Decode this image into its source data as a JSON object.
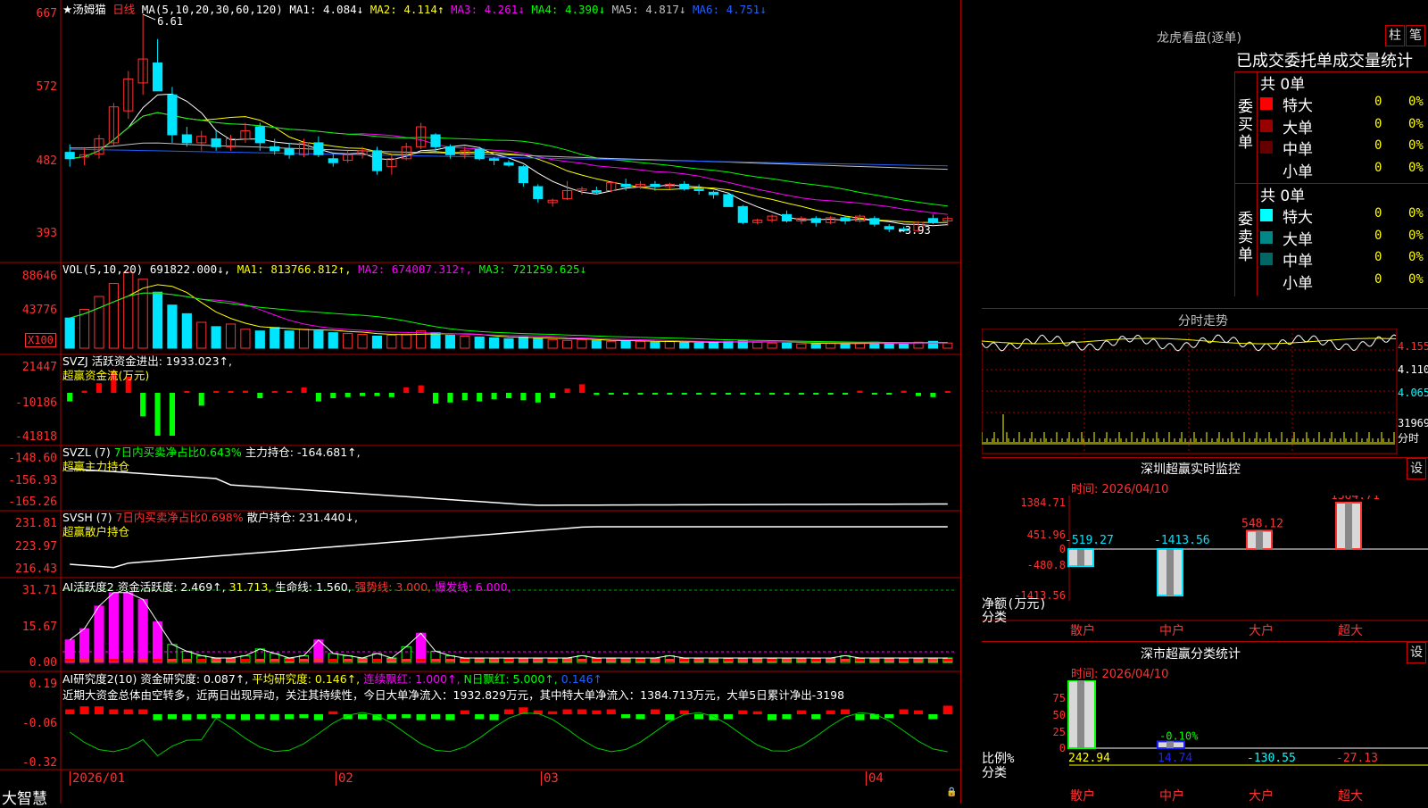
{
  "colors": {
    "up": "#ff3232",
    "down": "#00e5ff",
    "grid": "#b00000",
    "axis": "#ff3232"
  },
  "header": {
    "title": "★汤姆猫",
    "period": "日线",
    "ma_params": "MA(5,10,20,30,60,120)",
    "ma": [
      {
        "label": "MA1: 4.084↓",
        "color": "#ffffff"
      },
      {
        "label": "MA2: 4.114↑",
        "color": "#ffff00"
      },
      {
        "label": "MA3: 4.261↓",
        "color": "#ff00ff"
      },
      {
        "label": "MA4: 4.390↓",
        "color": "#00ff00"
      },
      {
        "label": "MA5: 4.817↓",
        "color": "#c0c0c0"
      },
      {
        "label": "MA6: 4.751↓",
        "color": "#2060ff"
      }
    ],
    "high_mark": "6.61",
    "low_mark": "←3.93"
  },
  "price_axis": [
    "667",
    "572",
    "482",
    "393"
  ],
  "vol": {
    "title": "VOL(5,10,20)",
    "value": "691822.000↓,",
    "ma": [
      {
        "label": "MA1: 813766.812↑,",
        "color": "#ffff00"
      },
      {
        "label": "MA2: 674007.312↑,",
        "color": "#ff00ff"
      },
      {
        "label": "MA3: 721259.625↓",
        "color": "#00ff00"
      }
    ],
    "axis": [
      "88646",
      "43776"
    ],
    "unit": "X100"
  },
  "svzj": {
    "title": "SVZJ",
    "line1": "活跃资金进出: 1933.023↑,",
    "line2": "超赢资金流(万元)",
    "axis": [
      "21447",
      "-10186",
      "-41818"
    ]
  },
  "svzl": {
    "title": "SVZL (7)",
    "ratio": "7日内买卖净占比0.643%",
    "value": "主力持仓: -164.681↑,",
    "line2": "超赢主力持仓",
    "axis": [
      "-148.60",
      "-156.93",
      "-165.26"
    ]
  },
  "svsh": {
    "title": "SVSH (7)",
    "ratio": "7日内买卖净占比0.698%",
    "value": "散户持仓: 231.440↓,",
    "line2": "超赢散户持仓",
    "axis": [
      "231.81",
      "223.97",
      "216.43"
    ]
  },
  "ai_active": {
    "title": "AI活跃度2",
    "items": [
      {
        "label": "资金活跃度: 2.469↑,",
        "color": "#ffffff"
      },
      {
        "label": "31.713,",
        "color": "#ffff00"
      },
      {
        "label": "生命线: 1.560,",
        "color": "#ffffff"
      },
      {
        "label": "强势线: 3.000,",
        "color": "#ff3232"
      },
      {
        "label": "爆发线: 6.000,",
        "color": "#ff00ff"
      }
    ],
    "axis": [
      "31.71",
      "15.67",
      "0.00"
    ]
  },
  "ai_research": {
    "title": "AI研究度2(10)",
    "items": [
      {
        "label": "资金研究度: 0.087↑,",
        "color": "#ffffff"
      },
      {
        "label": "平均研究度: 0.146↑,",
        "color": "#ffff00"
      },
      {
        "label": "连续飘红: 1.000↑,",
        "color": "#ff00ff"
      },
      {
        "label": "N日飘红: 5.000↑,",
        "color": "#00ff00"
      },
      {
        "label": "0.146↑",
        "color": "#2060ff"
      }
    ],
    "comment": "近期大资金总体由空转多，近两日出现异动，关注其持续性，今日大单净流入：1932.829万元，其中特大单净流入：1384.713万元，大单5日累计净出-3198",
    "axis": [
      "0.19",
      "-0.06",
      "-0.32"
    ]
  },
  "time_axis": {
    "labels": [
      "2026/01",
      "02",
      "03",
      "04"
    ],
    "brand": "大智慧"
  },
  "right": {
    "lhb": {
      "title": "龙虎看盘(逐单)",
      "btn1": "柱",
      "btn2": "笔",
      "tabs": "已成交委托单成交量统计",
      "buy_label": "委买单",
      "sell_label": "委卖单",
      "buy_total": "共 0单",
      "sell_total": "共 0单",
      "rows": [
        {
          "name": "特大",
          "count": "0",
          "pct": "0%"
        },
        {
          "name": "大单",
          "count": "0",
          "pct": "0%"
        },
        {
          "name": "中单",
          "count": "0",
          "pct": "0%"
        },
        {
          "name": "小单",
          "count": "0",
          "pct": "0%"
        }
      ],
      "buy_colors": [
        "#ff0000",
        "#990000",
        "#660000",
        "#000000"
      ],
      "sell_colors": [
        "#00ffff",
        "#008888",
        "#006666",
        "#000000"
      ]
    },
    "intraday": {
      "title": "分时走势",
      "axis": [
        "4.155",
        "4.110",
        "4.065"
      ],
      "vol_axis": [
        "31969",
        "分时"
      ]
    },
    "monitor": {
      "title": "深圳超赢实时监控",
      "btn": "设",
      "time": "时间: 2026/04/10",
      "axis": [
        "1384.71",
        "451.96",
        "0",
        "-480.8",
        "-1413.56"
      ],
      "ylabel": "净额(万元)",
      "xlabel": "分类",
      "bars": [
        {
          "cat": "散户",
          "value": -519.27,
          "label": "-519.27"
        },
        {
          "cat": "中户",
          "value": -1413.56,
          "label": "-1413.56"
        },
        {
          "cat": "大户",
          "value": 548.12,
          "label": "548.12"
        },
        {
          "cat": "超大",
          "value": 1384.71,
          "label": "1384.71"
        }
      ]
    },
    "classify": {
      "title": "深市超赢分类统计",
      "btn": "设",
      "time": "时间: 2026/04/10",
      "axis": [
        "75",
        "50",
        "25",
        "0"
      ],
      "ylabel": "比例%",
      "xlabel": "分类",
      "bars": [
        {
          "cat": "散户",
          "value": 100,
          "label": "242.94"
        },
        {
          "cat": "中户",
          "value": 10,
          "label": "14.74",
          "mark": "-0.10%"
        },
        {
          "cat": "大户",
          "value": 0,
          "label": "-130.55"
        },
        {
          "cat": "超大",
          "value": 0,
          "label": "-27.13"
        }
      ]
    }
  },
  "chart_data": [
    {
      "type": "candlestick",
      "title": "汤姆猫 日线",
      "ylim": [
        3.6,
        6.7
      ],
      "candles": [
        [
          4.88,
          4.98,
          4.7,
          4.8
        ],
        [
          4.82,
          4.93,
          4.72,
          4.85
        ],
        [
          4.86,
          5.1,
          4.8,
          5.05
        ],
        [
          5.0,
          5.5,
          4.95,
          5.45
        ],
        [
          5.4,
          5.9,
          5.3,
          5.8
        ],
        [
          5.75,
          6.61,
          5.6,
          6.05
        ],
        [
          6.0,
          6.3,
          5.7,
          5.65
        ],
        [
          5.6,
          5.7,
          5.0,
          5.1
        ],
        [
          5.1,
          5.2,
          4.95,
          5.0
        ],
        [
          5.0,
          5.15,
          4.9,
          5.08
        ],
        [
          5.05,
          5.15,
          4.9,
          4.95
        ],
        [
          4.95,
          5.1,
          4.9,
          5.05
        ],
        [
          5.05,
          5.25,
          5.0,
          5.15
        ],
        [
          5.2,
          5.25,
          4.9,
          5.0
        ],
        [
          4.95,
          5.05,
          4.85,
          4.9
        ],
        [
          4.92,
          5.0,
          4.8,
          4.85
        ],
        [
          4.85,
          5.05,
          4.82,
          5.0
        ],
        [
          5.0,
          5.08,
          4.82,
          4.85
        ],
        [
          4.8,
          4.88,
          4.7,
          4.75
        ],
        [
          4.78,
          4.9,
          4.75,
          4.85
        ],
        [
          4.85,
          4.95,
          4.8,
          4.9
        ],
        [
          4.9,
          4.95,
          4.6,
          4.65
        ],
        [
          4.7,
          4.85,
          4.6,
          4.8
        ],
        [
          4.8,
          5.0,
          4.78,
          4.95
        ],
        [
          4.95,
          5.25,
          4.92,
          5.2
        ],
        [
          5.1,
          5.12,
          4.9,
          4.95
        ],
        [
          4.95,
          4.98,
          4.8,
          4.85
        ],
        [
          4.85,
          4.95,
          4.8,
          4.9
        ],
        [
          4.92,
          4.95,
          4.78,
          4.8
        ],
        [
          4.8,
          4.82,
          4.72,
          4.78
        ],
        [
          4.75,
          4.78,
          4.7,
          4.72
        ],
        [
          4.7,
          4.72,
          4.45,
          4.5
        ],
        [
          4.45,
          4.48,
          4.25,
          4.3
        ],
        [
          4.25,
          4.3,
          4.2,
          4.28
        ],
        [
          4.3,
          4.52,
          4.28,
          4.4
        ],
        [
          4.4,
          4.45,
          4.35,
          4.42
        ],
        [
          4.4,
          4.45,
          4.35,
          4.38
        ],
        [
          4.4,
          4.52,
          4.38,
          4.5
        ],
        [
          4.48,
          4.55,
          4.4,
          4.45
        ],
        [
          4.45,
          4.52,
          4.42,
          4.48
        ],
        [
          4.48,
          4.52,
          4.4,
          4.45
        ],
        [
          4.45,
          4.5,
          4.42,
          4.48
        ],
        [
          4.48,
          4.52,
          4.4,
          4.42
        ],
        [
          4.42,
          4.48,
          4.35,
          4.4
        ],
        [
          4.38,
          4.4,
          4.3,
          4.35
        ],
        [
          4.35,
          4.38,
          4.2,
          4.2
        ],
        [
          4.2,
          4.22,
          3.98,
          4.0
        ],
        [
          4.0,
          4.05,
          3.98,
          4.03
        ],
        [
          4.03,
          4.1,
          4.0,
          4.08
        ],
        [
          4.1,
          4.15,
          4.0,
          4.02
        ],
        [
          4.02,
          4.08,
          3.98,
          4.05
        ],
        [
          4.05,
          4.08,
          3.95,
          4.0
        ],
        [
          4.0,
          4.08,
          3.98,
          4.06
        ],
        [
          4.06,
          4.08,
          3.98,
          4.02
        ],
        [
          4.02,
          4.1,
          4.0,
          4.08
        ],
        [
          4.05,
          4.08,
          3.95,
          3.98
        ],
        [
          3.95,
          3.98,
          3.88,
          3.92
        ],
        [
          3.92,
          3.95,
          3.88,
          3.9
        ],
        [
          3.9,
          4.02,
          3.88,
          4.0
        ],
        [
          4.05,
          4.1,
          3.98,
          4.0
        ],
        [
          4.02,
          4.08,
          3.96,
          4.05
        ]
      ],
      "volumes": [
        35,
        45,
        60,
        75,
        88,
        80,
        65,
        50,
        40,
        30,
        25,
        28,
        22,
        20,
        24,
        20,
        22,
        20,
        18,
        17,
        16,
        14,
        15,
        16,
        20,
        18,
        15,
        14,
        13,
        12,
        11,
        13,
        12,
        10,
        9,
        10,
        9,
        8,
        8,
        8,
        7,
        8,
        7,
        6,
        7,
        8,
        9,
        7,
        6,
        6,
        5,
        5,
        6,
        5,
        6,
        7,
        6,
        5,
        7,
        8,
        6
      ],
      "svzj": [
        -8,
        2,
        9,
        21,
        15,
        -22,
        -40,
        -40,
        0,
        -12,
        1,
        0,
        2,
        -5,
        1,
        1,
        5,
        -8,
        -5,
        -4,
        -3,
        -3,
        -4,
        5,
        7,
        -10,
        -9,
        -7,
        -8,
        -6,
        -5,
        -7,
        -9,
        -5,
        4,
        8,
        -2,
        -1,
        -1,
        -1,
        -1,
        -1,
        -1,
        -1,
        -1,
        -1,
        -1,
        -1,
        -1,
        -1,
        -1,
        -1,
        -1,
        -1,
        2,
        -1,
        -1,
        2,
        -3,
        -4,
        1
      ],
      "active": [
        10,
        15,
        25,
        31,
        31,
        28,
        18,
        8,
        5,
        3,
        2,
        2,
        3,
        6,
        4,
        2,
        3,
        10,
        4,
        3,
        2,
        4,
        2,
        7,
        13,
        5,
        3,
        2,
        2,
        2,
        2,
        2,
        2,
        2,
        2,
        3,
        2,
        2,
        2,
        2,
        2,
        3,
        2,
        2,
        2,
        2,
        2,
        2,
        2,
        2,
        2,
        2,
        2,
        3,
        2,
        2,
        2,
        2,
        2,
        2,
        2
      ],
      "research": [
        0.05,
        0.08,
        0.08,
        0.05,
        0.05,
        0.05,
        -0.06,
        -0.05,
        -0.06,
        -0.05,
        -0.04,
        -0.05,
        -0.06,
        -0.05,
        -0.06,
        -0.05,
        -0.04,
        -0.06,
        0.03,
        -0.05,
        -0.05,
        -0.06,
        -0.05,
        -0.04,
        -0.06,
        -0.05,
        -0.06,
        0.04,
        -0.05,
        -0.06,
        0.05,
        0.07,
        0.04,
        0.03,
        0.05,
        0.05,
        0.04,
        0.05,
        -0.04,
        -0.05,
        0.05,
        -0.06,
        0.04,
        -0.05,
        -0.06,
        -0.05,
        0.04,
        0.03,
        -0.06,
        -0.05,
        0.04,
        -0.05,
        0.04,
        0.05,
        -0.06,
        -0.05,
        -0.04,
        0.05,
        0.04,
        -0.05,
        0.087
      ]
    }
  ]
}
